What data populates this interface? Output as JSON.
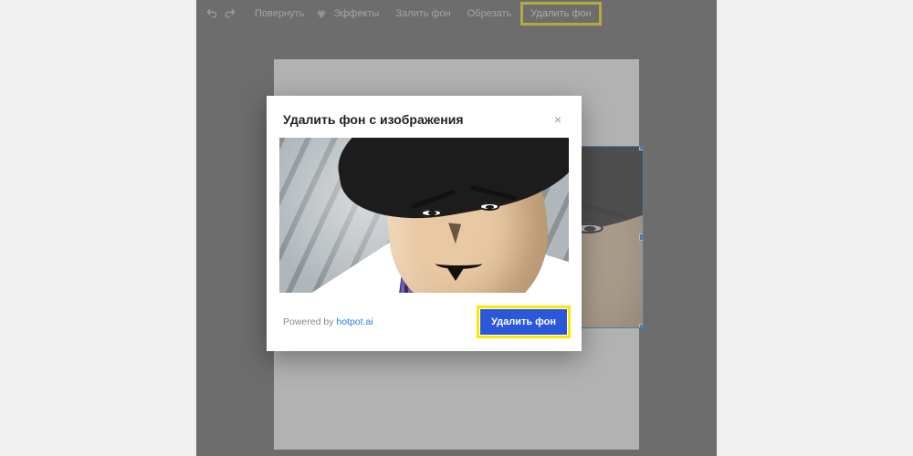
{
  "toolbar": {
    "rotate": "Повернуть",
    "effects": "Эффекты",
    "fill_bg": "Залить фон",
    "crop": "Обрезать",
    "remove_bg": "Удалить фон"
  },
  "modal": {
    "title": "Удалить фон с изображения",
    "powered_prefix": "Powered by ",
    "powered_link_text": "hotpot.ai",
    "button": "Удалить фон",
    "close_symbol": "×"
  }
}
